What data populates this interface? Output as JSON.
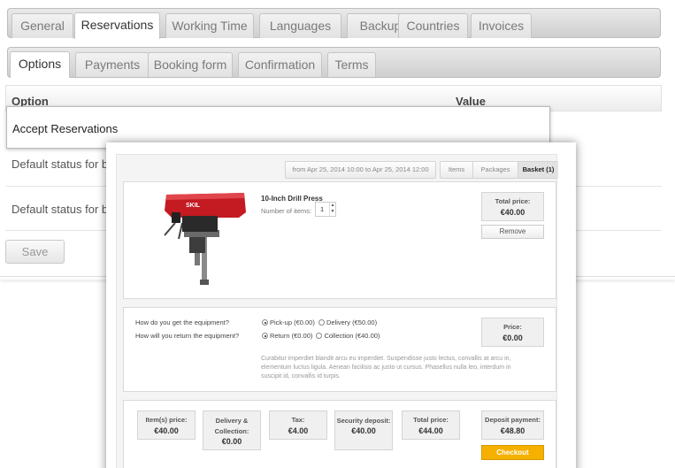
{
  "top_tabs": [
    "General",
    "Reservations",
    "Working Time",
    "Languages",
    "Backup",
    "Countries",
    "Invoices"
  ],
  "sub_tabs": [
    "Options",
    "Payments",
    "Booking form",
    "Confirmation",
    "Terms"
  ],
  "table": {
    "header_option": "Option",
    "header_value": "Value",
    "rows": [
      "Accept Reservations",
      "Default status for bo",
      "Default status for bo"
    ],
    "accept_checked": "✔"
  },
  "save_label": "Save",
  "modal": {
    "date_range": "from Apr 25, 2014 10:00 to Apr 25, 2014 12:00",
    "steps": [
      "Items",
      "Packages",
      "Basket (1)"
    ],
    "product": {
      "title": "10-Inch Drill Press",
      "items_label": "Number of items:",
      "quantity": "1",
      "total_label": "Total price:",
      "total_value": "€40.00",
      "remove_label": "Remove"
    },
    "delivery": {
      "q_get": "How do you get the equipment?",
      "q_return": "How will you return the equipment?",
      "pickup": "Pick-up (€0.00)",
      "delivery": "Delivery (€50.00)",
      "return": "Return (€0.00)",
      "collection": "Collection (€40.00)",
      "price_label": "Price:",
      "price_value": "€0.00",
      "lorem": "Curabitur imperdiet blandit arcu eu imperdiet. Suspendisse justo lectus, convallis at arcu in, elementum luctus ligula. Aenean facilisis ac justo ut cursus. Phasellus nulla leo, interdum in suscipit id, convallis id turpis."
    },
    "summary": {
      "items_label": "Item(s) price:",
      "items_value": "€40.00",
      "delivery_label": "Delivery & Collection:",
      "delivery_value": "€0.00",
      "tax_label": "Tax:",
      "tax_value": "€4.00",
      "security_label": "Security deposit:",
      "security_value": "€40.00",
      "total_label": "Total price:",
      "total_value": "€44.00",
      "deposit_label": "Deposit payment:",
      "deposit_value": "€48.80",
      "checkout_label": "Checkout"
    }
  },
  "colors": {
    "checkout": "#f5b000",
    "product_red": "#c41a22"
  }
}
